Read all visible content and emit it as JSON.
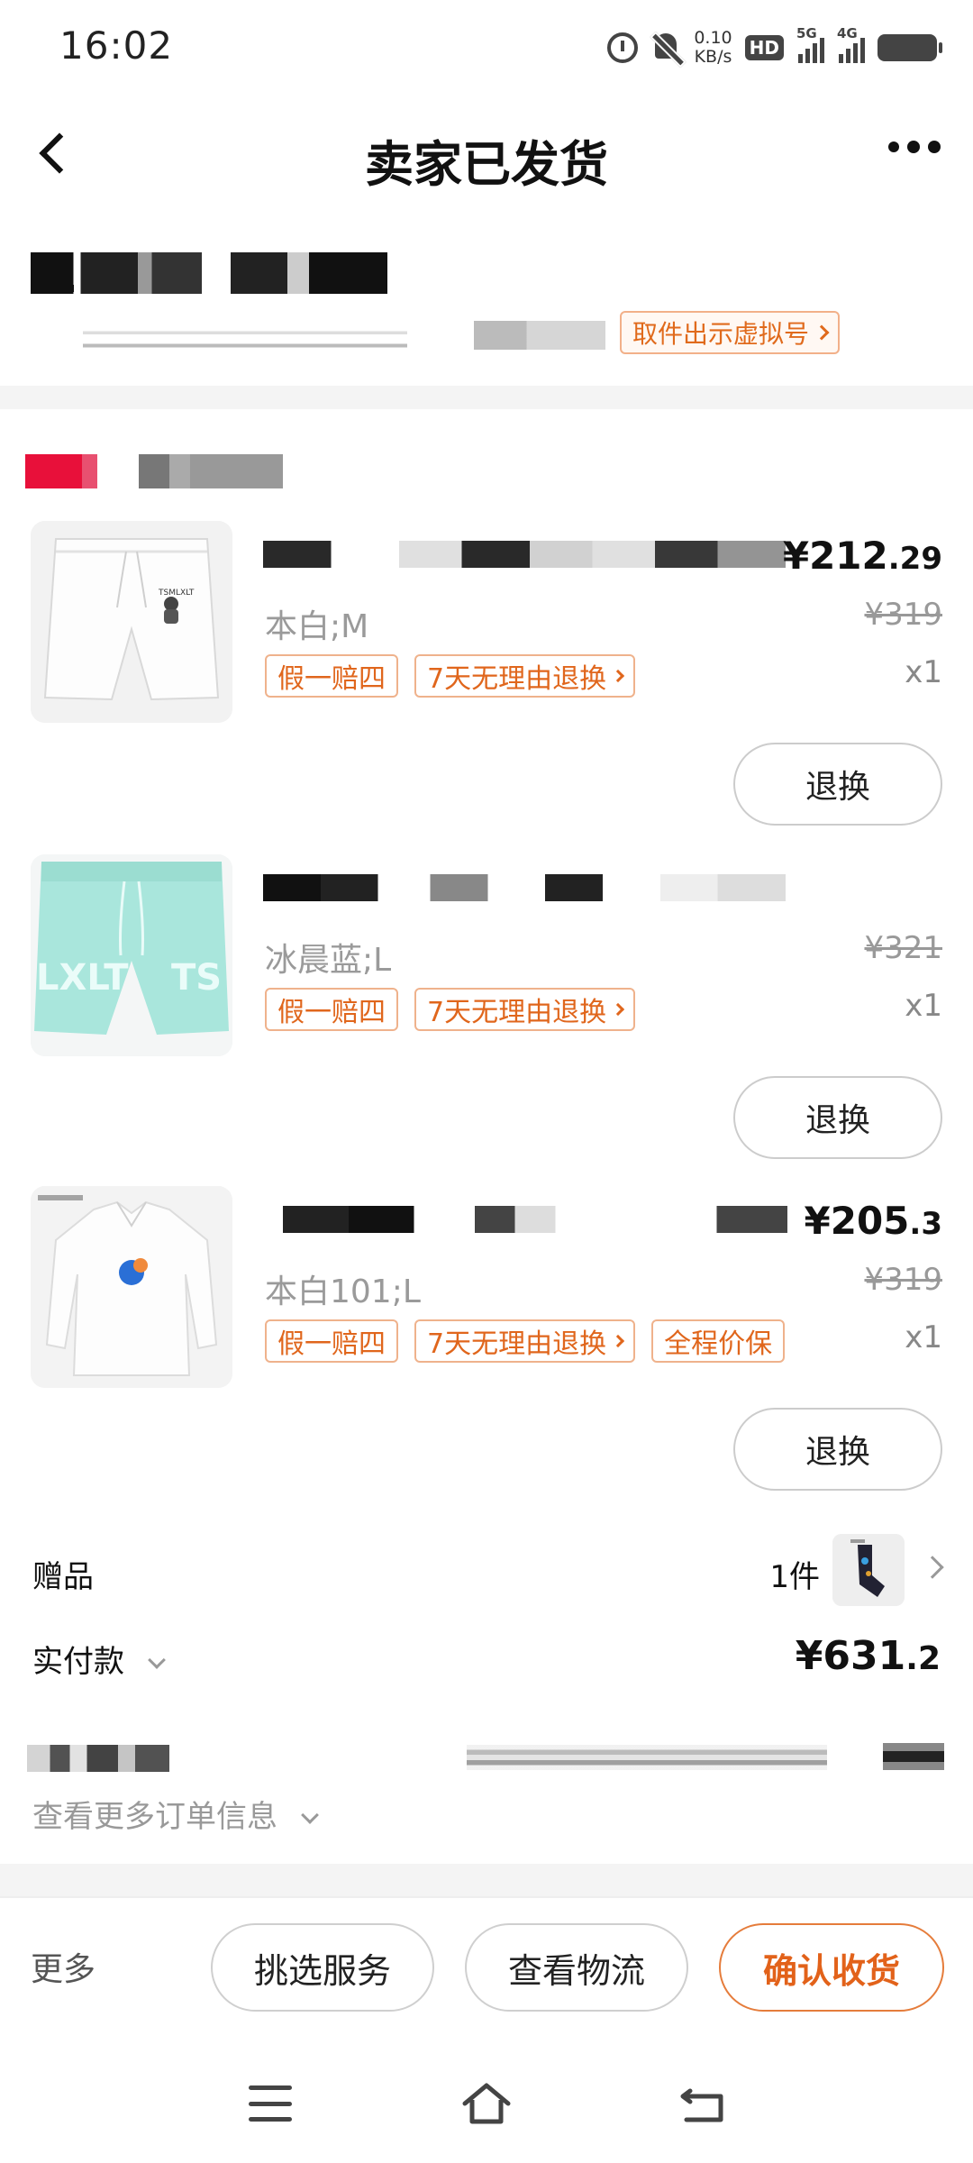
{
  "status_bar": {
    "time": "16:02",
    "net_speed_value": "0.10",
    "net_speed_unit": "KB/s",
    "hd_label": "HD",
    "signal1_label": "5G",
    "signal2_label": "4G"
  },
  "header": {
    "title": "卖家已发货"
  },
  "address": {
    "pickup_tag": "取件出示虚拟号"
  },
  "items": [
    {
      "spec": "本白;M",
      "tags": [
        "假一赔四",
        "7天无理由退换"
      ],
      "price_main": "¥212",
      "price_decimal": ".29",
      "original_price": "¥319",
      "quantity": "x1",
      "action": "退换"
    },
    {
      "spec": "冰晨蓝;L",
      "tags": [
        "假一赔四",
        "7天无理由退换"
      ],
      "price_main": "",
      "price_decimal": "",
      "original_price": "¥321",
      "quantity": "x1",
      "action": "退换"
    },
    {
      "spec": "本白101;L",
      "tags": [
        "假一赔四",
        "7天无理由退换",
        "全程价保"
      ],
      "price_main": "¥205",
      "price_decimal": ".3",
      "original_price": "¥319",
      "quantity": "x1",
      "action": "退换"
    }
  ],
  "gift": {
    "label": "赠品",
    "count": "1件"
  },
  "payment": {
    "label": "实付款",
    "amount_main": "¥631",
    "amount_decimal": ".2"
  },
  "order_info": {
    "more_label": "查看更多订单信息"
  },
  "action_bar": {
    "more": "更多",
    "select_service": "挑选服务",
    "view_logistics": "查看物流",
    "confirm_receipt": "确认收货"
  },
  "colors": {
    "accent": "#e2621a",
    "tag_border": "#efb28c",
    "muted": "#999999"
  }
}
